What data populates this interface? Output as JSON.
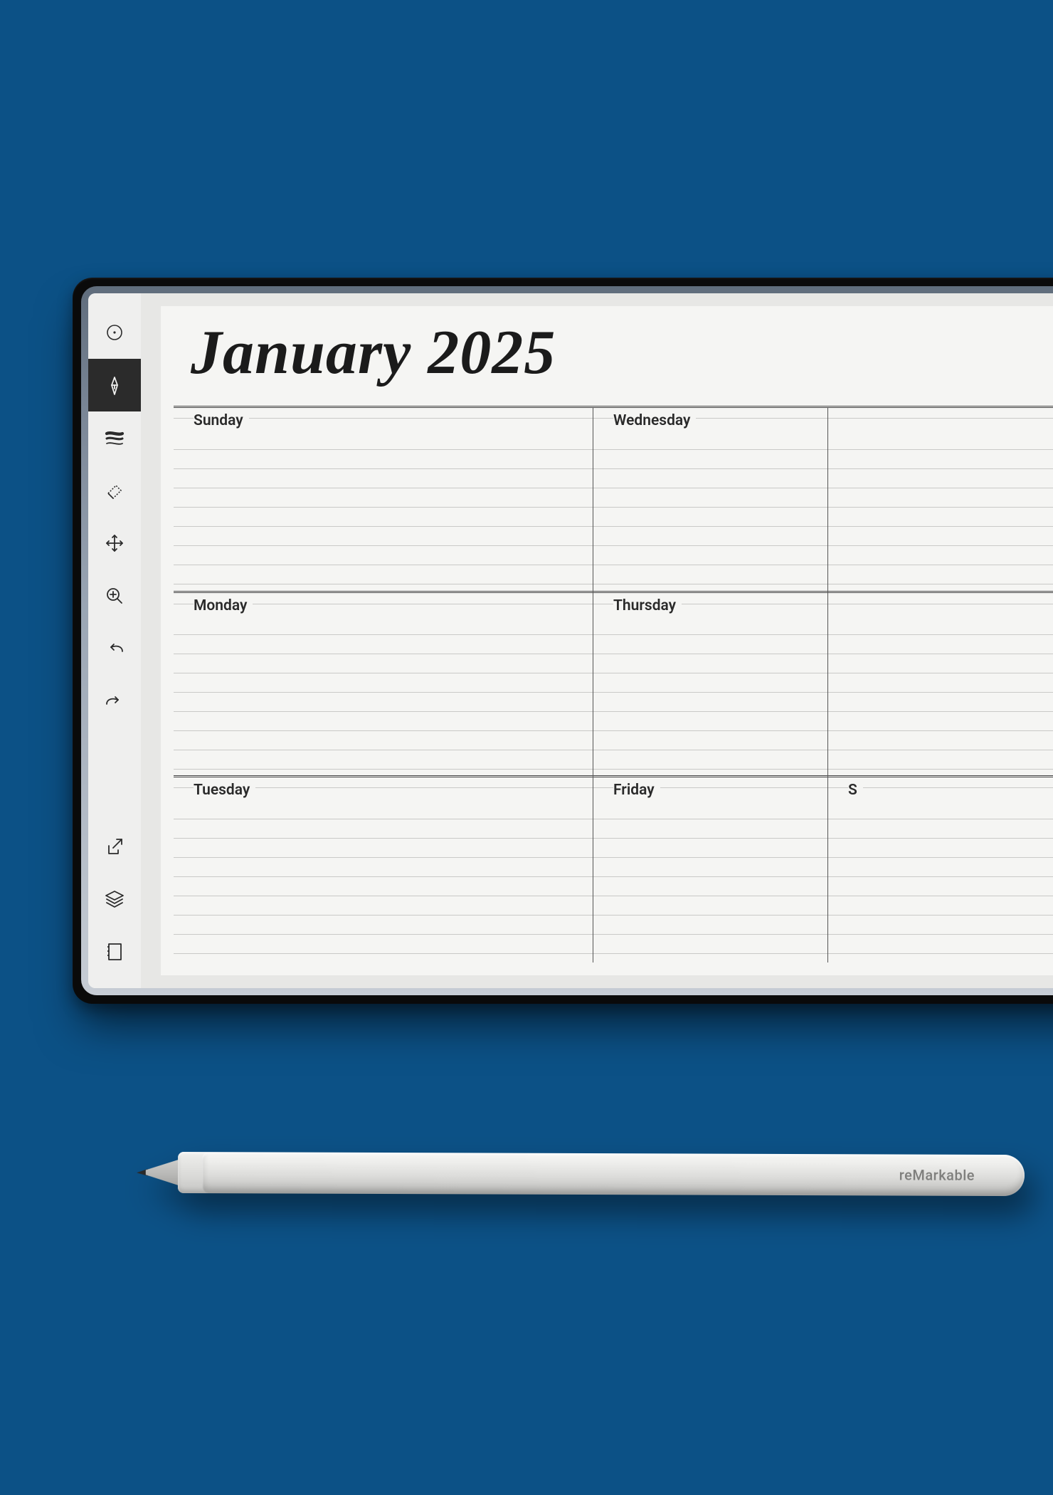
{
  "page": {
    "title": "January 2025"
  },
  "days": {
    "r0c0": "Sunday",
    "r0c1": "Wednesday",
    "r0c2": "",
    "r1c0": "Monday",
    "r1c1": "Thursday",
    "r1c2": "",
    "r2c0": "Tuesday",
    "r2c1": "Friday",
    "r2c2": "S"
  },
  "toolbar": {
    "items": [
      {
        "name": "options-icon"
      },
      {
        "name": "pen-icon",
        "active": true
      },
      {
        "name": "stroke-icon"
      },
      {
        "name": "eraser-icon"
      },
      {
        "name": "move-icon"
      },
      {
        "name": "zoom-in-icon"
      },
      {
        "name": "undo-icon"
      },
      {
        "name": "redo-icon"
      }
    ],
    "bottom": [
      {
        "name": "export-icon"
      },
      {
        "name": "layers-icon"
      },
      {
        "name": "page-icon"
      }
    ]
  },
  "stylus": {
    "brand": "reMarkable"
  }
}
